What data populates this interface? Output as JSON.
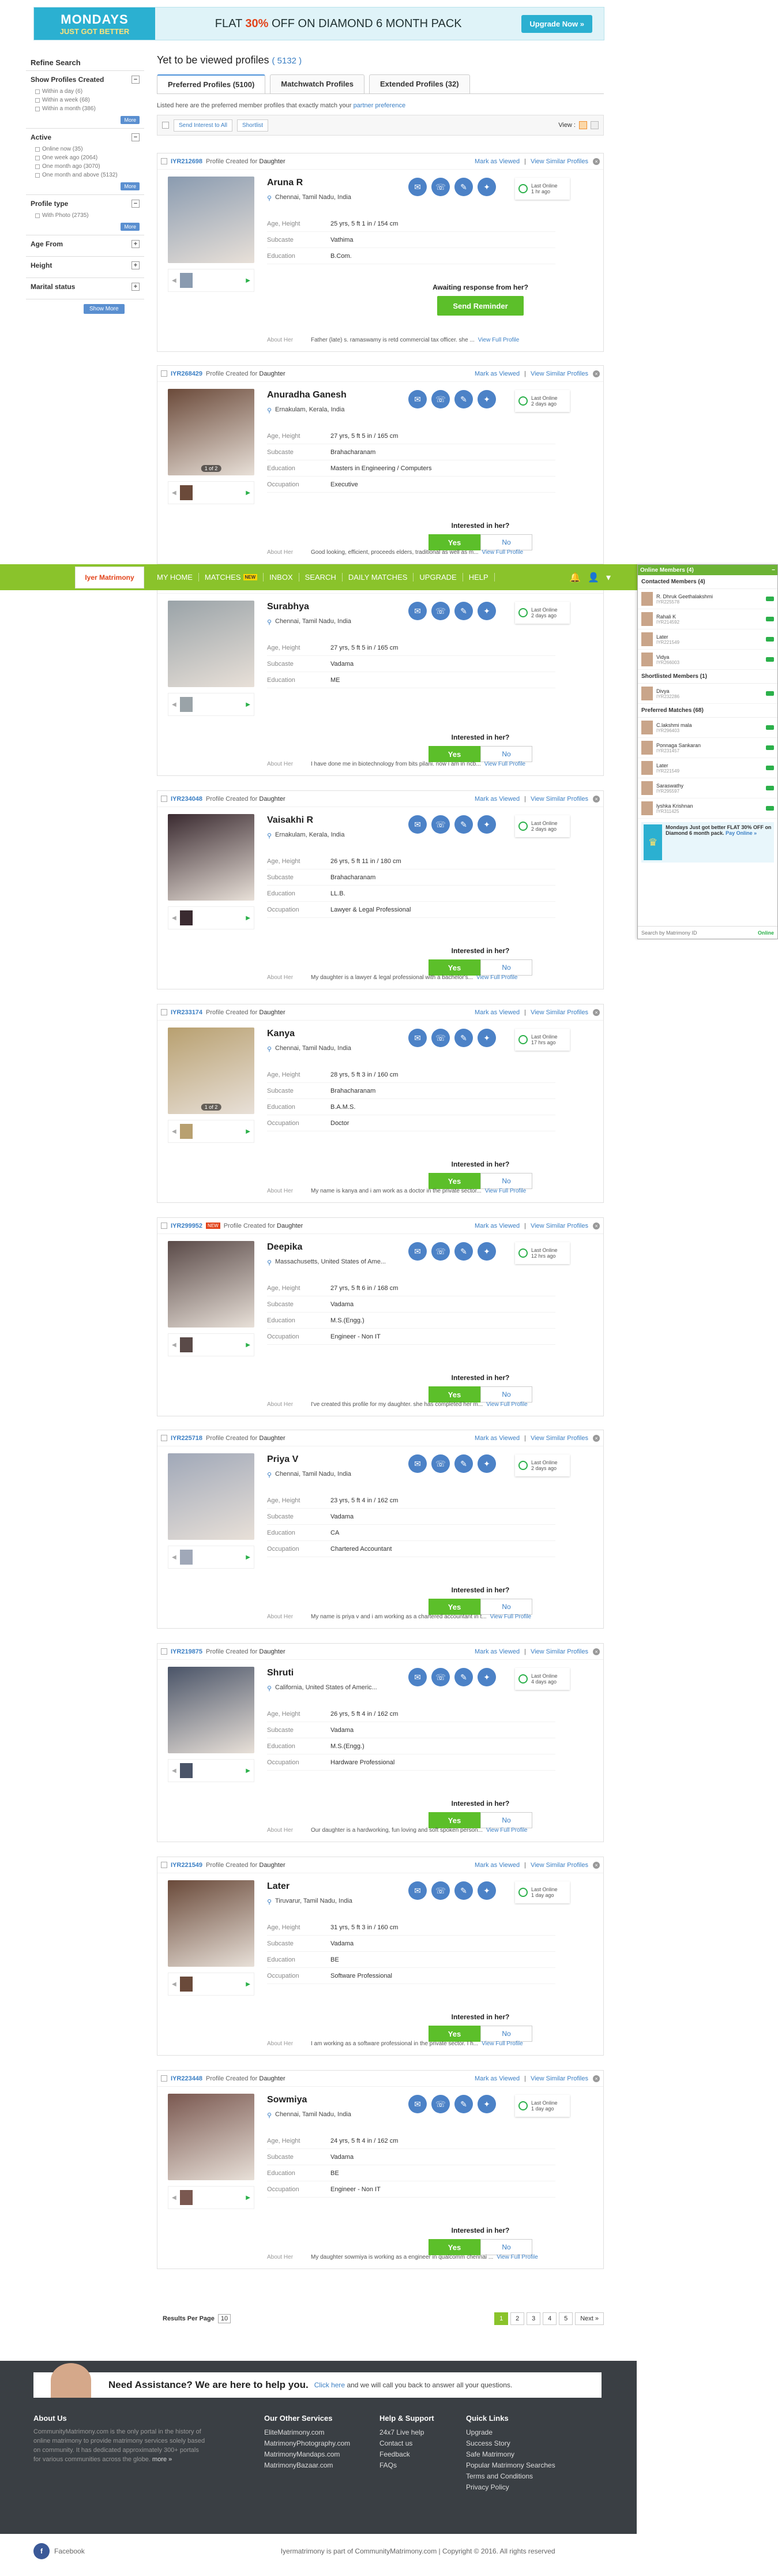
{
  "banner": {
    "brand_top": "MONDAYS",
    "brand_bottom": "JUST GOT BETTER",
    "offer_pre": "FLAT",
    "offer_pct": "30%",
    "offer_post": "OFF ON DIAMOND 6 MONTH PACK",
    "cta": "Upgrade Now »"
  },
  "sidebar": {
    "title": "Refine Search",
    "sections": [
      {
        "label": "Show Profiles Created",
        "toggle": "−",
        "options": [
          "Within a day (6)",
          "Within a week (68)",
          "Within a month (386)"
        ],
        "more": "More"
      },
      {
        "label": "Active",
        "toggle": "−",
        "options": [
          "Online now (35)",
          "One week ago (2064)",
          "One month ago (3070)",
          "One month and above (5132)"
        ],
        "more": "More"
      },
      {
        "label": "Profile type",
        "toggle": "−",
        "options": [
          "With Photo (2735)"
        ],
        "more": "More"
      },
      {
        "label": "Age From",
        "toggle": "+",
        "options": [],
        "more": ""
      },
      {
        "label": "Height",
        "toggle": "+",
        "options": [],
        "more": ""
      },
      {
        "label": "Marital status",
        "toggle": "+",
        "options": [],
        "more": ""
      }
    ],
    "show_more": "Show More"
  },
  "main": {
    "title": "Yet to be viewed profiles",
    "count": "( 5132 )",
    "tabs": [
      "Preferred Profiles (5100)",
      "Matchwatch Profiles",
      "Extended Profiles (32)"
    ],
    "intro": "Listed here are the preferred member profiles that exactly match your",
    "intro_link": "partner preference",
    "send_interest": "Send Interest to All",
    "shortlist": "Shortlist",
    "view_label": "View :"
  },
  "card_common": {
    "created_label": "Profile Created for",
    "mark_viewed": "Mark as Viewed",
    "view_similar": "View Similar Profiles",
    "about_label": "About Her",
    "view_full": "View Full Profile",
    "last_online_label": "Last Online",
    "interest_q": "Interested in her?",
    "yes": "Yes",
    "no": "No",
    "age_label": "Age, Height",
    "sub_label": "Subcaste",
    "edu_label": "Education",
    "occ_label": "Occupation"
  },
  "profiles": [
    {
      "id": "IYR212698",
      "created_for": "Daughter",
      "new": false,
      "name": "Aruna R",
      "location": "Chennai, Tamil Nadu, India",
      "age": "25 yrs, 5 ft 1 in / 154 cm",
      "subcaste": "Vathima",
      "education": "B.Com.",
      "occupation": "",
      "last_online": "1 hr ago",
      "about": "Father (late) s. ramaswamy is retd commercial tax officer. she ...",
      "awaiting": true,
      "awaiting_text": "Awaiting response from her?",
      "remind": "Send Reminder",
      "photos": "",
      "photo_color": "#8a9bb0"
    },
    {
      "id": "IYR268429",
      "created_for": "Daughter",
      "new": false,
      "name": "Anuradha Ganesh",
      "location": "Ernakulam, Kerala, India",
      "age": "27 yrs, 5 ft 5 in / 165 cm",
      "subcaste": "Brahacharanam",
      "education": "Masters in Engineering / Computers",
      "occupation": "Executive",
      "last_online": "2 days ago",
      "about": "Good looking, efficient, proceeds elders, traditional as well as m...",
      "awaiting": false,
      "photos": "1 of 2",
      "photo_color": "#6b4a3a"
    },
    {
      "id": "IYR203288",
      "created_for": "Daughter",
      "new": false,
      "name": "Surabhya",
      "location": "Chennai, Tamil Nadu, India",
      "age": "27 yrs, 5 ft 5 in / 165 cm",
      "subcaste": "Vadama",
      "education": "ME",
      "occupation": "",
      "last_online": "2 days ago",
      "about": "I have done me in biotechnology from bits pilani. now i am in ncb...",
      "awaiting": false,
      "photos": "",
      "photo_color": "#9aa3a8"
    },
    {
      "id": "IYR234048",
      "created_for": "Daughter",
      "new": false,
      "name": "Vaisakhi R",
      "location": "Ernakulam, Kerala, India",
      "age": "26 yrs, 5 ft 11 in / 180 cm",
      "subcaste": "Brahacharanam",
      "education": "LL.B.",
      "occupation": "Lawyer & Legal Professional",
      "last_online": "2 days ago",
      "about": "My daughter is a lawyer & legal professional with a bachelor's...",
      "awaiting": false,
      "photos": "",
      "photo_color": "#3a2a30"
    },
    {
      "id": "IYR233174",
      "created_for": "Daughter",
      "new": false,
      "name": "Kanya",
      "location": "Chennai, Tamil Nadu, India",
      "age": "28 yrs, 5 ft 3 in / 160 cm",
      "subcaste": "Brahacharanam",
      "education": "B.A.M.S.",
      "occupation": "Doctor",
      "last_online": "17 hrs ago",
      "about": "My name is kanya and i am work as a doctor in the private sector...",
      "awaiting": false,
      "photos": "1 of 2",
      "photo_color": "#b8a070"
    },
    {
      "id": "IYR299952",
      "created_for": "Daughter",
      "new": true,
      "name": "Deepika",
      "location": "Massachusetts, United States of Ame...",
      "age": "27 yrs, 5 ft 6 in / 168 cm",
      "subcaste": "Vadama",
      "education": "M.S.(Engg.)",
      "occupation": "Engineer - Non IT",
      "last_online": "12 hrs ago",
      "about": "I've created this profile for my daughter. she has completed her m...",
      "awaiting": false,
      "photos": "",
      "photo_color": "#5a4a48"
    },
    {
      "id": "IYR225718",
      "created_for": "Daughter",
      "new": false,
      "name": "Priya V",
      "location": "Chennai, Tamil Nadu, India",
      "age": "23 yrs, 5 ft 4 in / 162 cm",
      "subcaste": "Vadama",
      "education": "CA",
      "occupation": "Chartered Accountant",
      "last_online": "2 days ago",
      "about": "My name is priya v and i am working as a chartered accountant in t...",
      "awaiting": false,
      "photos": "",
      "photo_color": "#a0a8b8"
    },
    {
      "id": "IYR219875",
      "created_for": "Daughter",
      "new": false,
      "name": "Shruti",
      "location": "California, United States of Americ...",
      "age": "26 yrs, 5 ft 4 in / 162 cm",
      "subcaste": "Vadama",
      "education": "M.S.(Engg.)",
      "occupation": "Hardware Professional",
      "last_online": "4 days ago",
      "about": "Our daughter is a hardworking, fun loving and soft spoken person...",
      "awaiting": false,
      "photos": "",
      "photo_color": "#4a5468"
    },
    {
      "id": "IYR221549",
      "created_for": "Daughter",
      "new": false,
      "name": "Later",
      "location": "Tiruvarur, Tamil Nadu, India",
      "age": "31 yrs, 5 ft 3 in / 160 cm",
      "subcaste": "Vadama",
      "education": "BE",
      "occupation": "Software Professional",
      "last_online": "1 day ago",
      "about": "I am working as a software professional in the private sector. I h...",
      "awaiting": false,
      "photos": "",
      "photo_color": "#6a4a3a"
    },
    {
      "id": "IYR223448",
      "created_for": "Daughter",
      "new": false,
      "name": "Sowmiya",
      "location": "Chennai, Tamil Nadu, India",
      "age": "24 yrs, 5 ft 4 in / 162 cm",
      "subcaste": "Vadama",
      "education": "BE",
      "occupation": "Engineer - Non IT",
      "last_online": "1 day ago",
      "about": "My daughter sowmiya is working as a engineer in qualcomm chennai ...",
      "awaiting": false,
      "photos": "",
      "photo_color": "#7a5850"
    }
  ],
  "topnav": {
    "logo": "Iyer Matrimony",
    "items": [
      "MY HOME",
      "MATCHES",
      "INBOX",
      "SEARCH",
      "DAILY MATCHES",
      "UPGRADE",
      "HELP"
    ],
    "matches_badge": "NEW"
  },
  "chat": {
    "header": "Online Members (4)",
    "groups": [
      {
        "label": "Contacted Members (4)",
        "members": [
          {
            "name": "R. Dhruk Geethalakshmi",
            "id": "IYR225578"
          },
          {
            "name": "Rahali K",
            "id": "IYR214592"
          },
          {
            "name": "Later",
            "id": "IYR221549"
          },
          {
            "name": "Vidya",
            "id": "IYR266003"
          }
        ]
      },
      {
        "label": "Shortlisted Members (1)",
        "members": [
          {
            "name": "Divya",
            "id": "IYR232286"
          }
        ]
      },
      {
        "label": "Preferred Matches (68)",
        "members": [
          {
            "name": "C.lakshmi mala",
            "id": "IYR296403"
          },
          {
            "name": "Ponnaga Sankaran",
            "id": "IYR231457"
          },
          {
            "name": "Later",
            "id": "IYR221549"
          },
          {
            "name": "Saraswathy",
            "id": "IYR295597"
          },
          {
            "name": "lyshka Krishnan",
            "id": "IYR311425"
          }
        ]
      }
    ],
    "ad_title": "Mondays Just got better FLAT 30% OFF on Diamond 6 month pack.",
    "ad_link": "Pay Online »",
    "search": "Search by Matrimony ID",
    "status": "Online"
  },
  "pager": {
    "label": "Results Per Page",
    "value": "10",
    "pages": [
      "1",
      "2",
      "3",
      "4",
      "5"
    ],
    "next": "Next »"
  },
  "footer": {
    "assist_title": "Need Assistance? We are here to help you.",
    "assist_link": "Click here",
    "assist_rest": "and we will call you back to answer all your questions.",
    "about_title": "About Us",
    "about_text": "CommunityMatrimony.com is the only portal in the history of online matrimony to provide matrimony services solely based on community. It has dedicated approximately 300+ portals for various communities across the globe.",
    "about_more": "more »",
    "services_title": "Our Other Services",
    "services": [
      "EliteMatrimony.com",
      "MatrimonyPhotography.com",
      "MatrimonyMandaps.com",
      "MatrimonyBazaar.com"
    ],
    "help_title": "Help & Support",
    "help": [
      "24x7 Live help",
      "Contact us",
      "Feedback",
      "FAQs"
    ],
    "links_title": "Quick Links",
    "links": [
      "Upgrade",
      "Success Story",
      "Safe Matrimony",
      "Popular Matrimony Searches",
      "Terms and Conditions",
      "Privacy Policy"
    ],
    "facebook": "Facebook",
    "copyright": "Iyermatrimony is part of CommunityMatrimony.com | Copyright © 2016. All rights reserved"
  }
}
